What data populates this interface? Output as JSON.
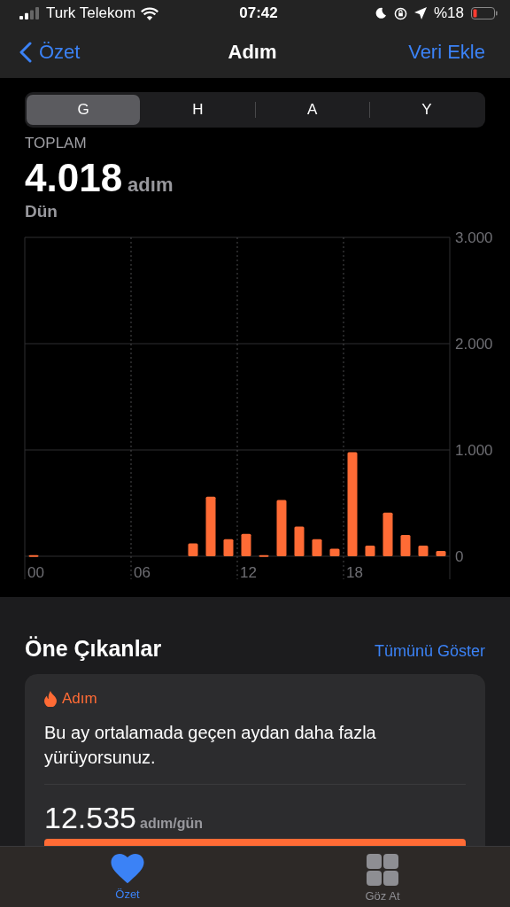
{
  "status_bar": {
    "carrier": "Turk Telekom",
    "time": "07:42",
    "battery": "%18"
  },
  "nav": {
    "back": "Özet",
    "title": "Adım",
    "action": "Veri Ekle"
  },
  "segments": [
    {
      "label": "G",
      "selected": true
    },
    {
      "label": "H",
      "selected": false
    },
    {
      "label": "A",
      "selected": false
    },
    {
      "label": "Y",
      "selected": false
    }
  ],
  "summary": {
    "label": "TOPLAM",
    "value": "4.018",
    "unit": "adım",
    "date": "Dün"
  },
  "chart_data": {
    "type": "bar",
    "x": [
      0,
      9,
      10,
      11,
      12,
      13,
      14,
      15,
      16,
      17,
      18,
      19,
      20,
      21,
      22,
      23
    ],
    "xlim": [
      -0.5,
      23.5
    ],
    "series": [
      {
        "color": "#ff6b35",
        "values": [
          10,
          120,
          560,
          160,
          210,
          10,
          530,
          280,
          160,
          70,
          980,
          100,
          410,
          200,
          100,
          50
        ]
      }
    ],
    "ylim": [
      0,
      3000
    ],
    "yticks": [
      {
        "value": 0,
        "label": "0"
      },
      {
        "value": 1000,
        "label": "1.000"
      },
      {
        "value": 2000,
        "label": "2.000"
      },
      {
        "value": 3000,
        "label": "3.000"
      }
    ],
    "xticks": [
      {
        "value": 0,
        "label": "00"
      },
      {
        "value": 6,
        "label": "06"
      },
      {
        "value": 12,
        "label": "12"
      },
      {
        "value": 18,
        "label": "18"
      }
    ]
  },
  "highlights": {
    "title": "Öne Çıkanlar",
    "link": "Tümünü Göster",
    "card": {
      "category": "Adım",
      "message": "Bu ay ortalamada geçen aydan daha fazla yürüyorsunuz.",
      "value": "12.535",
      "unit": "adım/gün"
    }
  },
  "tab_bar": [
    {
      "label": "Özet",
      "selected": true
    },
    {
      "label": "Göz At",
      "selected": false
    }
  ]
}
